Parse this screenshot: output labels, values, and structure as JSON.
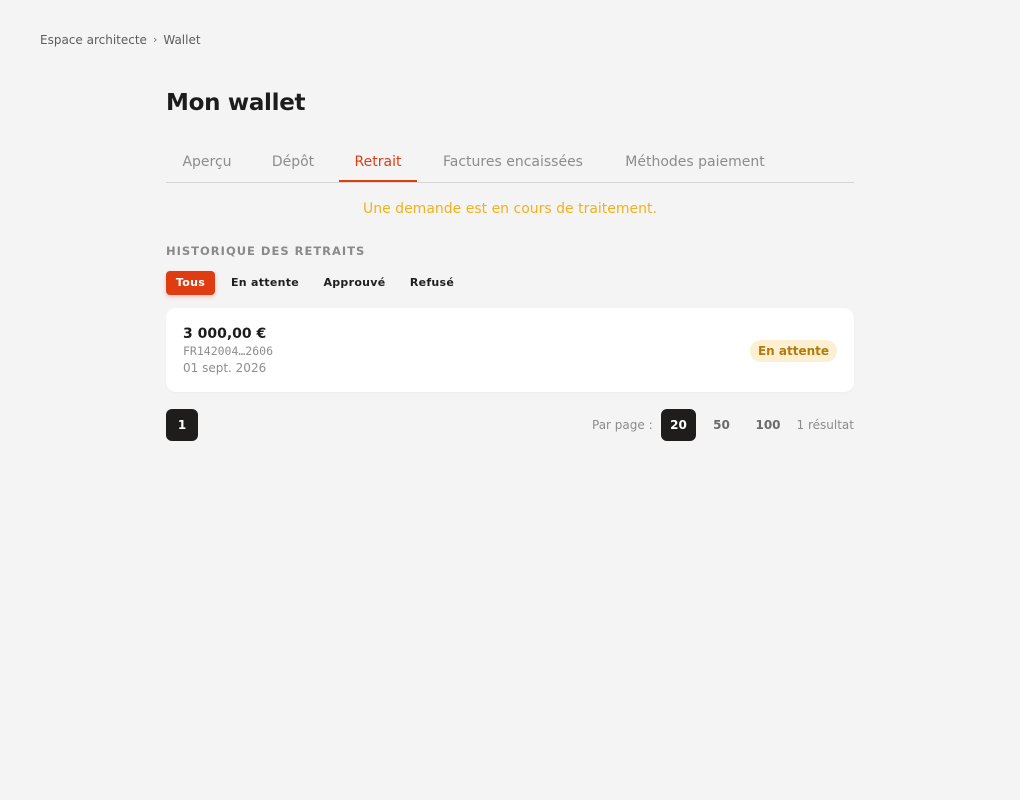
{
  "breadcrumb": {
    "parent": "Espace architecte",
    "separator": "›",
    "current": "Wallet"
  },
  "page": {
    "title": "Mon wallet"
  },
  "tabs": [
    {
      "label": "Aperçu",
      "active": false
    },
    {
      "label": "Dépôt",
      "active": false
    },
    {
      "label": "Retrait",
      "active": true
    },
    {
      "label": "Factures encaissées",
      "active": false
    },
    {
      "label": "Méthodes paiement",
      "active": false
    }
  ],
  "notice": "Une demande est en cours de traitement.",
  "history": {
    "title": "HISTORIQUE DES RETRAITS",
    "filters": [
      {
        "label": "Tous",
        "active": true
      },
      {
        "label": "En attente",
        "active": false
      },
      {
        "label": "Approuvé",
        "active": false
      },
      {
        "label": "Refusé",
        "active": false
      }
    ],
    "items": [
      {
        "amount": "3 000,00 €",
        "iban": "FR142004…2606",
        "date": "01 sept. 2026",
        "status": "En attente"
      }
    ]
  },
  "pagination": {
    "pages": [
      "1"
    ],
    "per_page_label": "Par page :",
    "per_page_options": [
      "20",
      "50",
      "100"
    ],
    "per_page_selected": "20",
    "results": "1 résultat"
  },
  "colors": {
    "accent": "#e03c12",
    "notice": "#f0b21c",
    "pending_badge_bg": "#fdf0d2",
    "pending_badge_text": "#b57a0a",
    "dark": "#1f1c1c"
  }
}
